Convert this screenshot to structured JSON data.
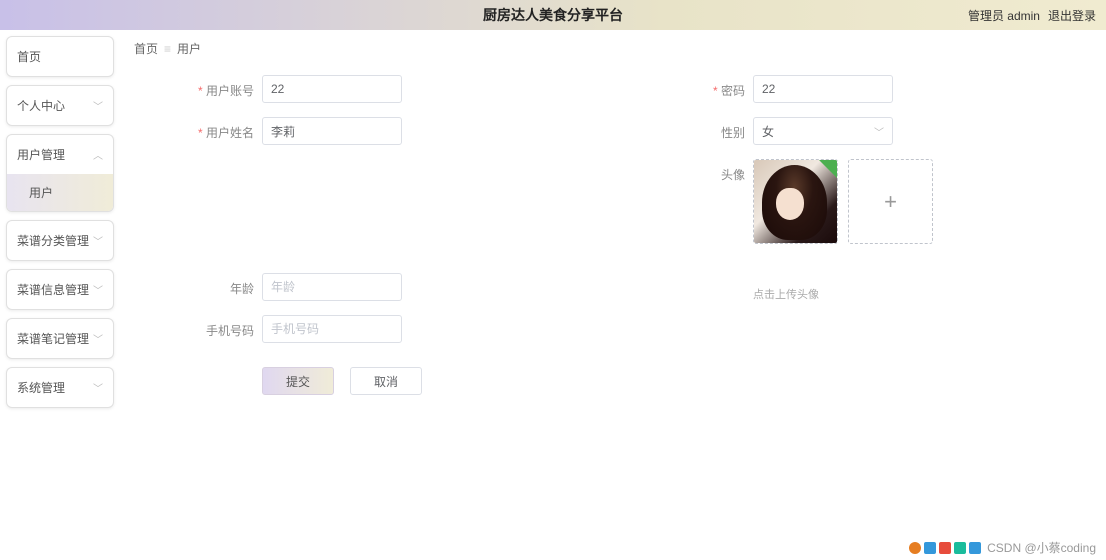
{
  "header": {
    "title": "厨房达人美食分享平台",
    "role_label": "管理员 admin",
    "logout": "退出登录"
  },
  "sidebar": {
    "items": [
      {
        "label": "首页",
        "expandable": false
      },
      {
        "label": "个人中心",
        "expandable": true
      },
      {
        "label": "用户管理",
        "expandable": true,
        "expanded": true,
        "sub": "用户"
      },
      {
        "label": "菜谱分类管理",
        "expandable": true
      },
      {
        "label": "菜谱信息管理",
        "expandable": true
      },
      {
        "label": "菜谱笔记管理",
        "expandable": true
      },
      {
        "label": "系统管理",
        "expandable": true
      }
    ]
  },
  "breadcrumb": {
    "root": "首页",
    "current": "用户"
  },
  "form": {
    "account": {
      "label": "用户账号",
      "value": "22"
    },
    "name": {
      "label": "用户姓名",
      "value": "李莉"
    },
    "password": {
      "label": "密码",
      "value": "22"
    },
    "gender": {
      "label": "性别",
      "value": "女"
    },
    "avatar": {
      "label": "头像",
      "hint": "点击上传头像"
    },
    "age": {
      "label": "年龄",
      "placeholder": "年龄",
      "value": ""
    },
    "phone": {
      "label": "手机号码",
      "placeholder": "手机号码",
      "value": ""
    }
  },
  "actions": {
    "submit": "提交",
    "cancel": "取消"
  },
  "watermark": {
    "text": "CSDN @小蔡coding"
  }
}
